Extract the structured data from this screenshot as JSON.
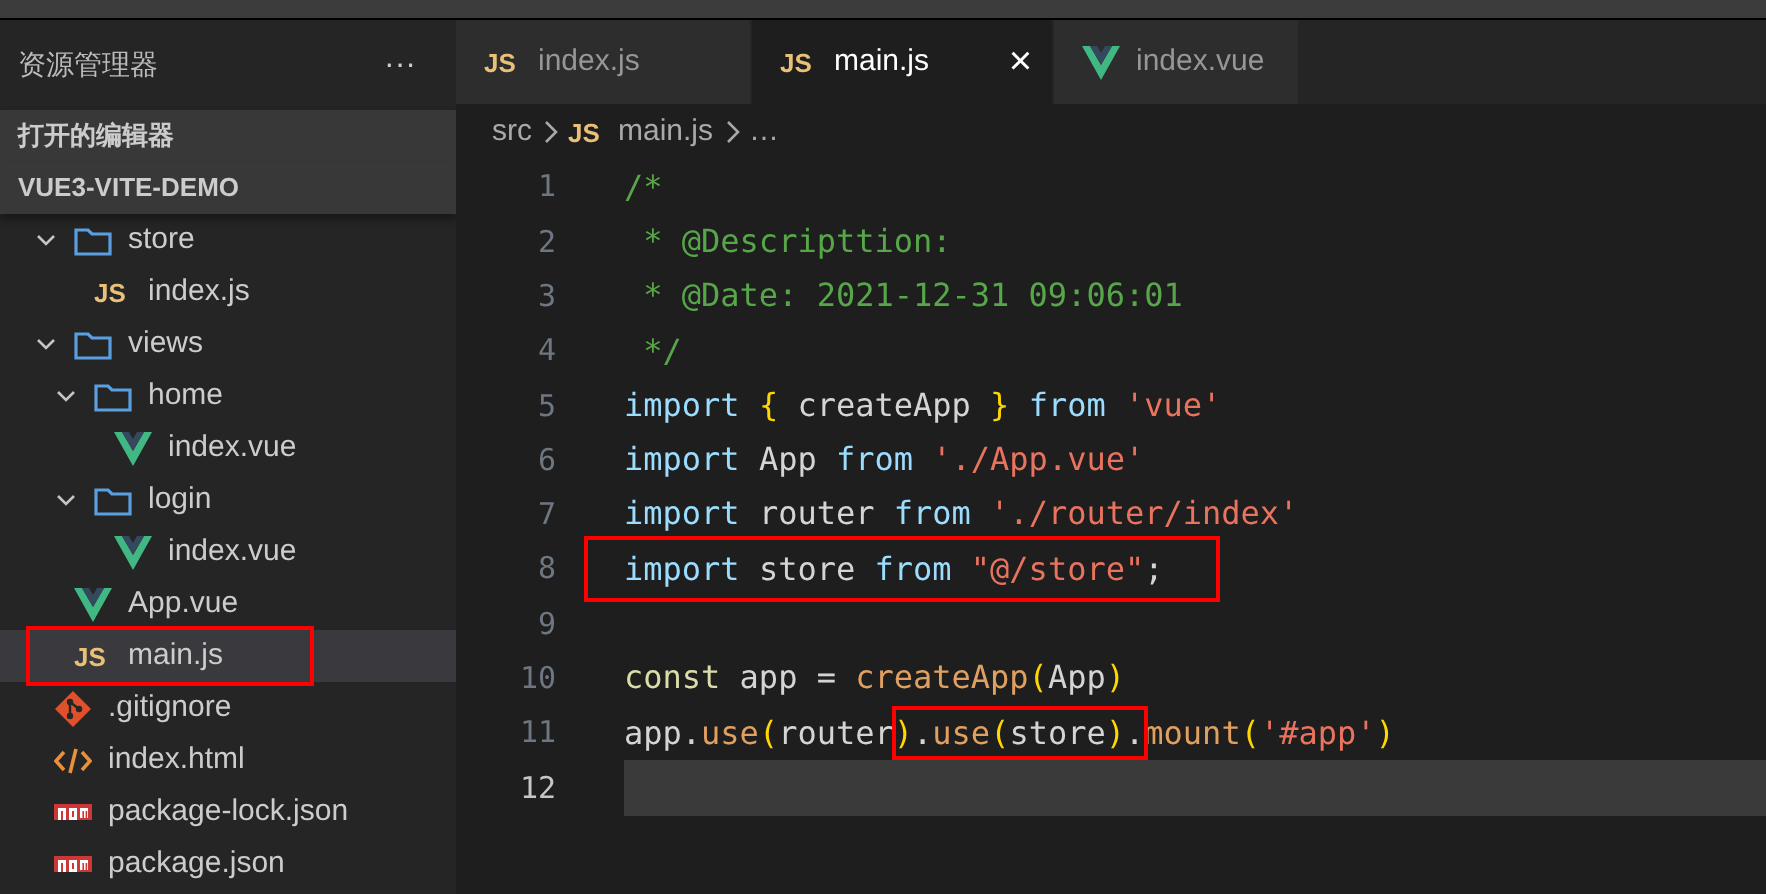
{
  "explorer": {
    "title": "资源管理器",
    "more": "···",
    "sections": [
      {
        "label": "打开的编辑器"
      },
      {
        "label": "VUE3-VITE-DEMO"
      }
    ],
    "tree": {
      "nested_items": [
        {
          "label": "store",
          "kind": "folder",
          "expanded": true,
          "selected": false,
          "children": [
            {
              "label": "index.js",
              "kind": "js",
              "badge": "JS",
              "selected": false
            }
          ]
        },
        {
          "label": "views",
          "kind": "folder",
          "expanded": true,
          "selected": false,
          "children": [
            {
              "label": "home",
              "kind": "folder",
              "expanded": true,
              "selected": false,
              "children": [
                {
                  "label": "index.vue",
                  "kind": "vue",
                  "selected": false
                }
              ]
            },
            {
              "label": "login",
              "kind": "folder",
              "expanded": true,
              "selected": false,
              "children": [
                {
                  "label": "index.vue",
                  "kind": "vue",
                  "selected": false
                }
              ]
            }
          ]
        },
        {
          "label": "App.vue",
          "kind": "vue",
          "selected": false
        },
        {
          "label": "main.js",
          "kind": "js",
          "badge": "JS",
          "selected": true,
          "annotated": true
        }
      ],
      "items": [
        {
          "label": ".gitignore",
          "kind": "git",
          "selected": false
        },
        {
          "label": "index.html",
          "kind": "html",
          "selected": false
        },
        {
          "label": "package-lock.json",
          "kind": "npm",
          "selected": false
        },
        {
          "label": "package.json",
          "kind": "npm",
          "selected": false
        }
      ]
    }
  },
  "tabs": [
    {
      "kind": "js",
      "badge": "JS",
      "label": "index.js",
      "selected": false
    },
    {
      "kind": "js",
      "badge": "JS",
      "label": "main.js",
      "selected": true,
      "close": "×"
    },
    {
      "kind": "vue",
      "label": "index.vue",
      "selected": false
    }
  ],
  "breadcrumb": [
    {
      "label": "src"
    },
    {
      "kind": "js",
      "badge": "JS",
      "label": "main.js"
    },
    {
      "label": "…"
    }
  ],
  "code": {
    "lines": [
      {
        "number": "1",
        "tokens": [
          {
            "text": "/*",
            "kind": "comment"
          }
        ]
      },
      {
        "number": "2",
        "tokens": [
          {
            "text": " * @Descripttion:",
            "kind": "comment"
          }
        ]
      },
      {
        "number": "3",
        "tokens": [
          {
            "text": " * @Date: 2021-12-31 09:06:01",
            "kind": "comment"
          }
        ]
      },
      {
        "number": "4",
        "tokens": [
          {
            "text": " */",
            "kind": "comment"
          }
        ]
      },
      {
        "number": "5",
        "tokens": [
          {
            "text": "import ",
            "kind": "keyword"
          },
          {
            "text": "{",
            "kind": "bracket"
          },
          {
            "text": " createApp ",
            "kind": "plain"
          },
          {
            "text": "}",
            "kind": "bracket"
          },
          {
            "text": " from ",
            "kind": "keyword"
          },
          {
            "text": "'vue'",
            "kind": "string"
          }
        ]
      },
      {
        "number": "6",
        "tokens": [
          {
            "text": "import ",
            "kind": "keyword"
          },
          {
            "text": "App ",
            "kind": "plain"
          },
          {
            "text": "from ",
            "kind": "keyword"
          },
          {
            "text": "'./App.vue'",
            "kind": "string"
          }
        ]
      },
      {
        "number": "7",
        "tokens": [
          {
            "text": "import ",
            "kind": "keyword"
          },
          {
            "text": "router ",
            "kind": "plain"
          },
          {
            "text": "from ",
            "kind": "keyword"
          },
          {
            "text": "'./router/index'",
            "kind": "string"
          }
        ]
      },
      {
        "number": "8",
        "boxed": true,
        "tokens": [
          {
            "text": "import ",
            "kind": "keyword"
          },
          {
            "text": "store ",
            "kind": "plain"
          },
          {
            "text": "from ",
            "kind": "keyword"
          },
          {
            "text": "\"@/store\"",
            "kind": "string"
          },
          {
            "text": ";",
            "kind": "plain"
          }
        ]
      },
      {
        "number": "9"
      },
      {
        "number": "10",
        "tokens": [
          {
            "text": "const ",
            "kind": "storage"
          },
          {
            "text": "app = ",
            "kind": "plain"
          },
          {
            "text": "createApp",
            "kind": "function"
          },
          {
            "text": "(",
            "kind": "bracket"
          },
          {
            "text": "App",
            "kind": "plain"
          },
          {
            "text": ")",
            "kind": "bracket"
          }
        ]
      },
      {
        "number": "11",
        "tokens": [
          {
            "text": "app.",
            "kind": "plain"
          },
          {
            "text": "use",
            "kind": "function"
          },
          {
            "text": "(",
            "kind": "bracket"
          },
          {
            "text": "router",
            "kind": "plain"
          },
          {
            "kind": "boxed",
            "tokens": [
              {
                "text": ")",
                "kind": "bracket"
              },
              {
                "text": ".",
                "kind": "plain"
              },
              {
                "text": "use",
                "kind": "function"
              },
              {
                "text": "(",
                "kind": "bracket"
              },
              {
                "text": "store",
                "kind": "plain"
              },
              {
                "text": ")",
                "kind": "bracket"
              },
              {
                "text": ".",
                "kind": "plain"
              }
            ]
          },
          {
            "text": "mount",
            "kind": "function"
          },
          {
            "text": "(",
            "kind": "bracket"
          },
          {
            "text": "'#app'",
            "kind": "string"
          },
          {
            "text": ")",
            "kind": "bracket"
          }
        ]
      },
      {
        "number": "12",
        "current": true
      }
    ]
  }
}
